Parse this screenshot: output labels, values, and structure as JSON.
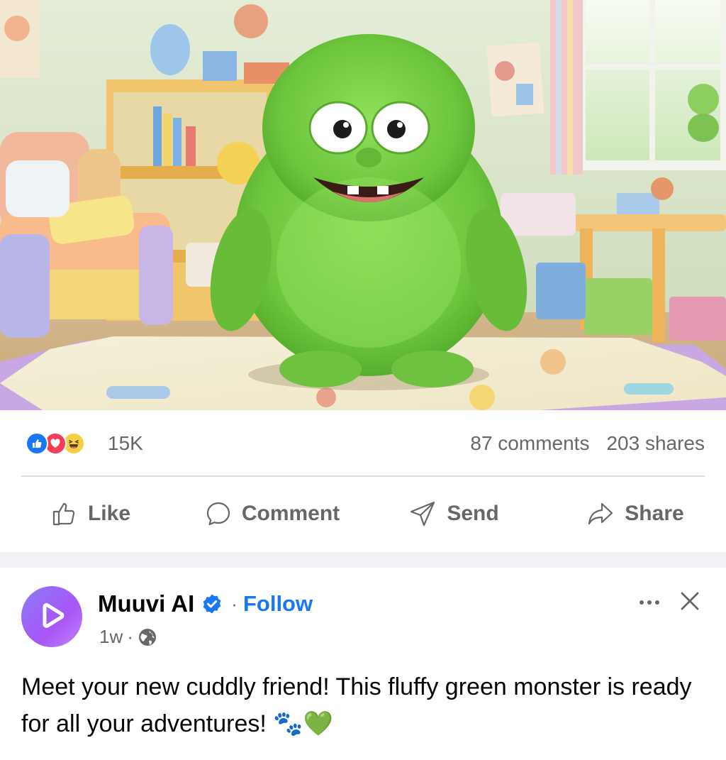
{
  "post_image": {
    "alt": ""
  },
  "engagement": {
    "reactions": [
      "like-icon",
      "love-icon",
      "haha-icon"
    ],
    "reaction_count": "15K",
    "comments": "87 comments",
    "shares": "203 shares"
  },
  "actions": {
    "like": "Like",
    "comment": "Comment",
    "send": "Send",
    "share": "Share"
  },
  "post": {
    "author": "Muuvi AI",
    "separator": "·",
    "follow": "Follow",
    "time": "1w",
    "visibility_icon": "globe-icon",
    "caption": "Meet your new cuddly friend! This fluffy green monster is ready for all your adventures! 🐾💚"
  },
  "colors": {
    "accent": "#1877f2",
    "secondary_text": "#65676b",
    "primary_text": "#050505",
    "avatar_gradient_start": "#8b7cf6",
    "avatar_gradient_end": "#c084fc",
    "monster_green": "#7ed04a"
  }
}
